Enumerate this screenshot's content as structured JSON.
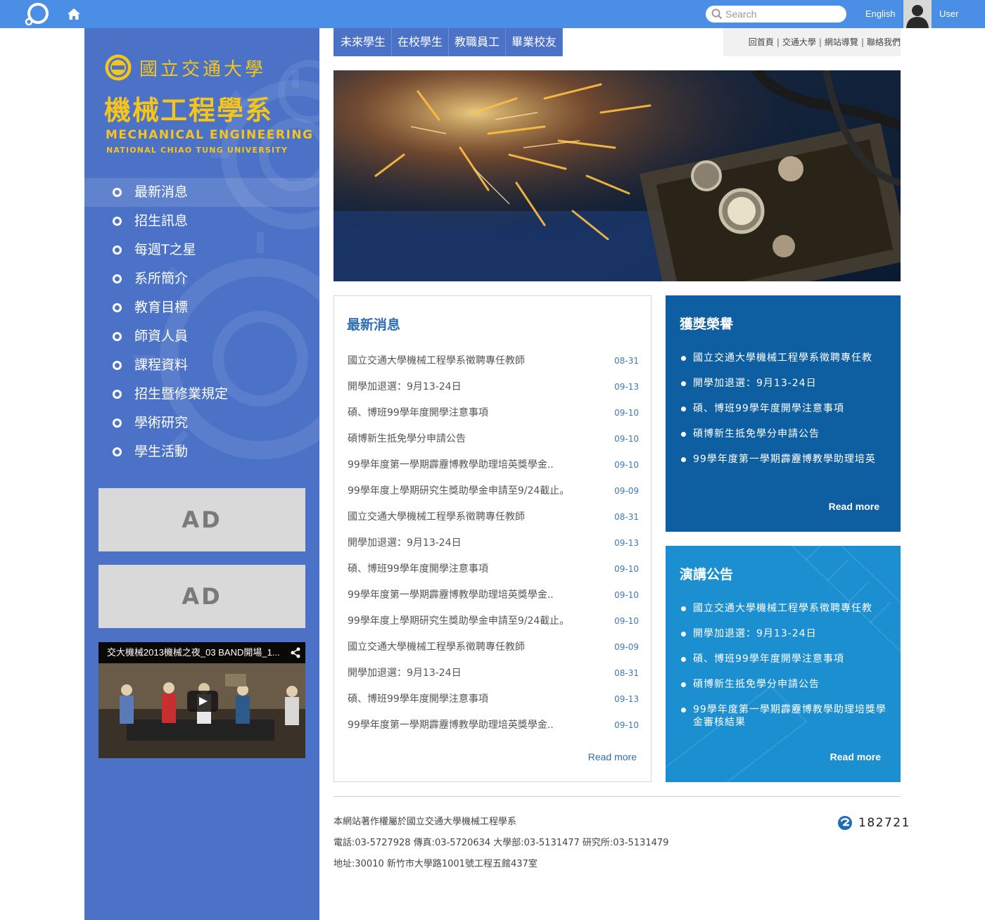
{
  "topbar": {
    "search_placeholder": "Search",
    "language": "English",
    "user": "User",
    "colors": {
      "bar": "#4a8ee6"
    }
  },
  "icons": [
    "ring-logo-icon",
    "home-icon",
    "search-icon",
    "avatar-icon",
    "emblem-icon",
    "share-icon",
    "play-icon",
    "counter-icon"
  ],
  "sidebar": {
    "univ_cn": "國立交通大學",
    "dept_cn": "機械工程學系",
    "dept_en": "MECHANICAL ENGINEERING",
    "univ_en": "NATIONAL CHIAO TUNG UNIVERSITY",
    "menu": [
      "最新消息",
      "招生訊息",
      "每週T之星",
      "系所簡介",
      "教育目標",
      "師資人員",
      "課程資料",
      "招生暨修業規定",
      "學術研究",
      "學生活動"
    ],
    "ads": [
      "AD",
      "AD"
    ],
    "video_title": "交大機械2013機械之夜_03 BAND開場_1...",
    "colors": {
      "background": "#4c72c8",
      "logo_text": "#f5c51c"
    }
  },
  "tabs": [
    "未來學生",
    "在校學生",
    "教職員工",
    "畢業校友"
  ],
  "utilnav": [
    "回首頁",
    "交通大學",
    "網站導覽",
    "聯絡我們"
  ],
  "news": {
    "title": "最新消息",
    "items": [
      {
        "title": "國立交通大學機械工程學系徵聘專任教師",
        "date": "08-31"
      },
      {
        "title": "開學加退選：9月13-24日",
        "date": "09-13"
      },
      {
        "title": "碩、博班99學年度開學注意事項",
        "date": "09-10"
      },
      {
        "title": "碩博新生抵免學分申請公告",
        "date": "09-10"
      },
      {
        "title": "99學年度第一學期霹靂博教學助理培英獎學金..",
        "date": "09-10"
      },
      {
        "title": "99學年度上學期研究生獎助學金申請至9/24截止。",
        "date": "09-09"
      },
      {
        "title": "國立交通大學機械工程學系徵聘專任教師",
        "date": "08-31"
      },
      {
        "title": "開學加退選：9月13-24日",
        "date": "09-13"
      },
      {
        "title": "碩、博班99學年度開學注意事項",
        "date": "09-10"
      },
      {
        "title": "99學年度第一學期霹靂博教學助理培英獎學金..",
        "date": "09-10"
      },
      {
        "title": "99學年度上學期研究生獎助學金申請至9/24截止。",
        "date": "09-10"
      },
      {
        "title": "國立交通大學機械工程學系徵聘專任教師",
        "date": "09-09"
      },
      {
        "title": "開學加退選：9月13-24日",
        "date": "08-31"
      },
      {
        "title": "碩、博班99學年度開學注意事項",
        "date": "09-13"
      },
      {
        "title": "99學年度第一學期霹靂博教學助理培英獎學金..",
        "date": "09-10"
      }
    ],
    "more": "Read more"
  },
  "awards": {
    "title": "獲獎榮譽",
    "items": [
      "國立交通大學機械工程學系徵聘專任教",
      "開學加退選：9月13-24日",
      "碩、博班99學年度開學注意事項",
      "碩博新生抵免學分申請公告",
      "99學年度第一學期霹靂博教學助理培英"
    ],
    "more": "Read more",
    "colors": {
      "background": "#0e5fa1"
    }
  },
  "lectures": {
    "title": "演講公告",
    "items": [
      "國立交通大學機械工程學系徵聘專任教",
      "開學加退選：9月13-24日",
      "碩、博班99學年度開學注意事項",
      "碩博新生抵免學分申請公告",
      "99學年度第一學期霹靂博教學助理培獎學金審核結果"
    ],
    "more": "Read more",
    "colors": {
      "background": "#1c8fd1"
    }
  },
  "footer": {
    "copyright": "本網站著作權屬於國立交通大學機械工程學系",
    "contact": "電話:03-5727928   傳真:03-5720634   大學部:03-5131477   研究所:03-5131479",
    "address": "地址:30010 新竹市大學路1001號工程五館437室",
    "counter": "182721"
  }
}
